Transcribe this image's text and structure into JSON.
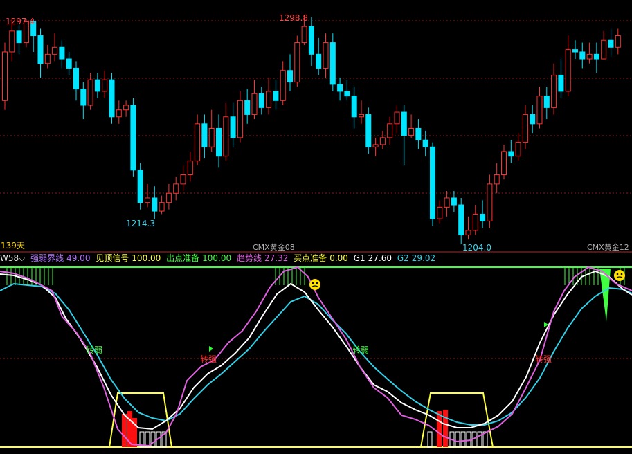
{
  "colors": {
    "background": "#000000",
    "up": "#ff3232",
    "down": "#00e5ff",
    "grid": "#8b1a1a",
    "label_red": "#ff4545",
    "label_cyan": "#3ad6f0",
    "line_pink": "#e060e0",
    "line_white": "#ffffff",
    "line_cyan": "#30d0e8",
    "line_yellow": "#ffff40",
    "line_green": "#40ff40",
    "bar_red": "#ff1010"
  },
  "main": {
    "high1": "1297.4",
    "high2": "1298.8",
    "low1": "1214.3",
    "low2": "1204.0",
    "days": "139天",
    "contract1": "CMX黄金08",
    "contract2": "CMX黄金12"
  },
  "indicator": {
    "name": "W58",
    "menu_icon": "chevron-down-icon",
    "l1_label": "强弱界线",
    "l1_value": "49.00",
    "l2_label": "见顶信号",
    "l2_value": "100.00",
    "l3_label": "出点准备",
    "l3_value": "100.00",
    "l4_label": "趋势线",
    "l4_value": "27.32",
    "l5_label": "买点准备",
    "l5_value": "0.00",
    "l6_label": "G1",
    "l6_value": "27.60",
    "l7_label": "G2",
    "l7_value": "29.02",
    "weak_text": "转弱",
    "strong_text": "转强",
    "signal_icon": "smiley-face-icon"
  },
  "chart_data": {
    "type": "candlestick",
    "series": [
      {
        "values": [
          [
            1262,
            1283,
            1287,
            1258
          ],
          [
            1283,
            1292,
            1297.4,
            1279
          ],
          [
            1292,
            1287,
            1295,
            1282
          ],
          [
            1287,
            1296,
            1297,
            1285
          ],
          [
            1296,
            1290,
            1297,
            1283
          ],
          [
            1290,
            1278,
            1293,
            1272
          ],
          [
            1278,
            1282,
            1286,
            1276
          ],
          [
            1282,
            1285,
            1291,
            1279
          ],
          [
            1285,
            1280,
            1288,
            1276
          ],
          [
            1280,
            1276,
            1283,
            1273
          ],
          [
            1276,
            1267,
            1279,
            1262
          ],
          [
            1267,
            1260,
            1270,
            1254
          ],
          [
            1260,
            1271,
            1274,
            1258
          ],
          [
            1271,
            1266,
            1274,
            1263
          ],
          [
            1266,
            1271,
            1275,
            1263
          ],
          [
            1271,
            1255,
            1274,
            1252
          ],
          [
            1255,
            1258,
            1262,
            1252
          ],
          [
            1258,
            1260,
            1262,
            1255
          ],
          [
            1260,
            1232,
            1263,
            1229
          ],
          [
            1232,
            1218,
            1235,
            1215
          ],
          [
            1218,
            1220,
            1226,
            1216
          ],
          [
            1220,
            1214.3,
            1225,
            1211
          ],
          [
            1214.3,
            1218,
            1221,
            1213
          ],
          [
            1218,
            1222,
            1226,
            1215
          ],
          [
            1222,
            1226,
            1229,
            1219
          ],
          [
            1226,
            1230,
            1234,
            1223
          ],
          [
            1230,
            1236,
            1240,
            1227
          ],
          [
            1236,
            1252,
            1256,
            1234
          ],
          [
            1252,
            1242,
            1256,
            1237
          ],
          [
            1242,
            1250,
            1258,
            1240
          ],
          [
            1250,
            1238,
            1256,
            1233
          ],
          [
            1238,
            1255,
            1261,
            1236
          ],
          [
            1255,
            1246,
            1261,
            1242
          ],
          [
            1246,
            1262,
            1266,
            1244
          ],
          [
            1262,
            1256,
            1267,
            1252
          ],
          [
            1256,
            1265,
            1271,
            1254
          ],
          [
            1265,
            1259,
            1268,
            1256
          ],
          [
            1259,
            1266,
            1272,
            1256
          ],
          [
            1266,
            1262,
            1271,
            1258
          ],
          [
            1262,
            1275,
            1279,
            1260
          ],
          [
            1275,
            1270,
            1282,
            1266
          ],
          [
            1270,
            1287,
            1290,
            1268
          ],
          [
            1287,
            1294,
            1298.8,
            1286
          ],
          [
            1294,
            1282,
            1298,
            1277
          ],
          [
            1282,
            1276,
            1289,
            1273
          ],
          [
            1276,
            1287,
            1291,
            1272
          ],
          [
            1287,
            1269,
            1291,
            1266
          ],
          [
            1269,
            1266,
            1272,
            1262
          ],
          [
            1266,
            1264,
            1271,
            1262
          ],
          [
            1264,
            1255,
            1268,
            1250
          ],
          [
            1255,
            1256,
            1262,
            1252
          ],
          [
            1256,
            1242,
            1259,
            1239
          ],
          [
            1242,
            1243,
            1246,
            1238
          ],
          [
            1243,
            1246,
            1249,
            1241
          ],
          [
            1246,
            1252,
            1255,
            1243
          ],
          [
            1252,
            1257,
            1260,
            1248
          ],
          [
            1257,
            1247,
            1260,
            1234
          ],
          [
            1247,
            1250,
            1256,
            1246
          ],
          [
            1250,
            1245,
            1254,
            1241
          ],
          [
            1245,
            1242,
            1249,
            1238
          ],
          [
            1242,
            1211,
            1244,
            1208
          ],
          [
            1211,
            1216,
            1219,
            1209
          ],
          [
            1216,
            1220,
            1223,
            1212
          ],
          [
            1220,
            1217,
            1223,
            1214
          ],
          [
            1217,
            1204,
            1220,
            1200
          ],
          [
            1204,
            1206,
            1212,
            1202
          ],
          [
            1206,
            1213,
            1217,
            1204
          ],
          [
            1213,
            1210,
            1219,
            1207
          ],
          [
            1210,
            1226,
            1230,
            1207
          ],
          [
            1226,
            1230,
            1235,
            1222
          ],
          [
            1230,
            1240,
            1243,
            1228
          ],
          [
            1240,
            1238,
            1245,
            1235
          ],
          [
            1238,
            1244,
            1248,
            1236
          ],
          [
            1244,
            1256,
            1260,
            1241
          ],
          [
            1256,
            1252,
            1260,
            1248
          ],
          [
            1252,
            1264,
            1268,
            1250
          ],
          [
            1264,
            1259,
            1268,
            1254
          ],
          [
            1259,
            1273,
            1278,
            1256
          ],
          [
            1273,
            1266,
            1280,
            1263
          ],
          [
            1266,
            1284,
            1290,
            1264
          ],
          [
            1284,
            1283,
            1288,
            1280
          ],
          [
            1283,
            1280,
            1287,
            1276
          ],
          [
            1280,
            1282,
            1287,
            1278
          ],
          [
            1282,
            1280,
            1287,
            1274
          ],
          [
            1280,
            1288,
            1292,
            1285
          ],
          [
            1288,
            1285,
            1293,
            1281
          ],
          [
            1285,
            1290,
            1293,
            1282
          ]
        ]
      }
    ],
    "annotations": [
      "1297.4",
      "1298.8",
      "1214.3",
      "1204.0"
    ],
    "indicator_levels": {
      "weak_strong_line": 49.0,
      "top_signal": 100.0,
      "exit_prepare": 100.0,
      "trend_line": 27.32,
      "buy_prepare": 0.0,
      "G1": 27.6,
      "G2": 29.02
    }
  }
}
